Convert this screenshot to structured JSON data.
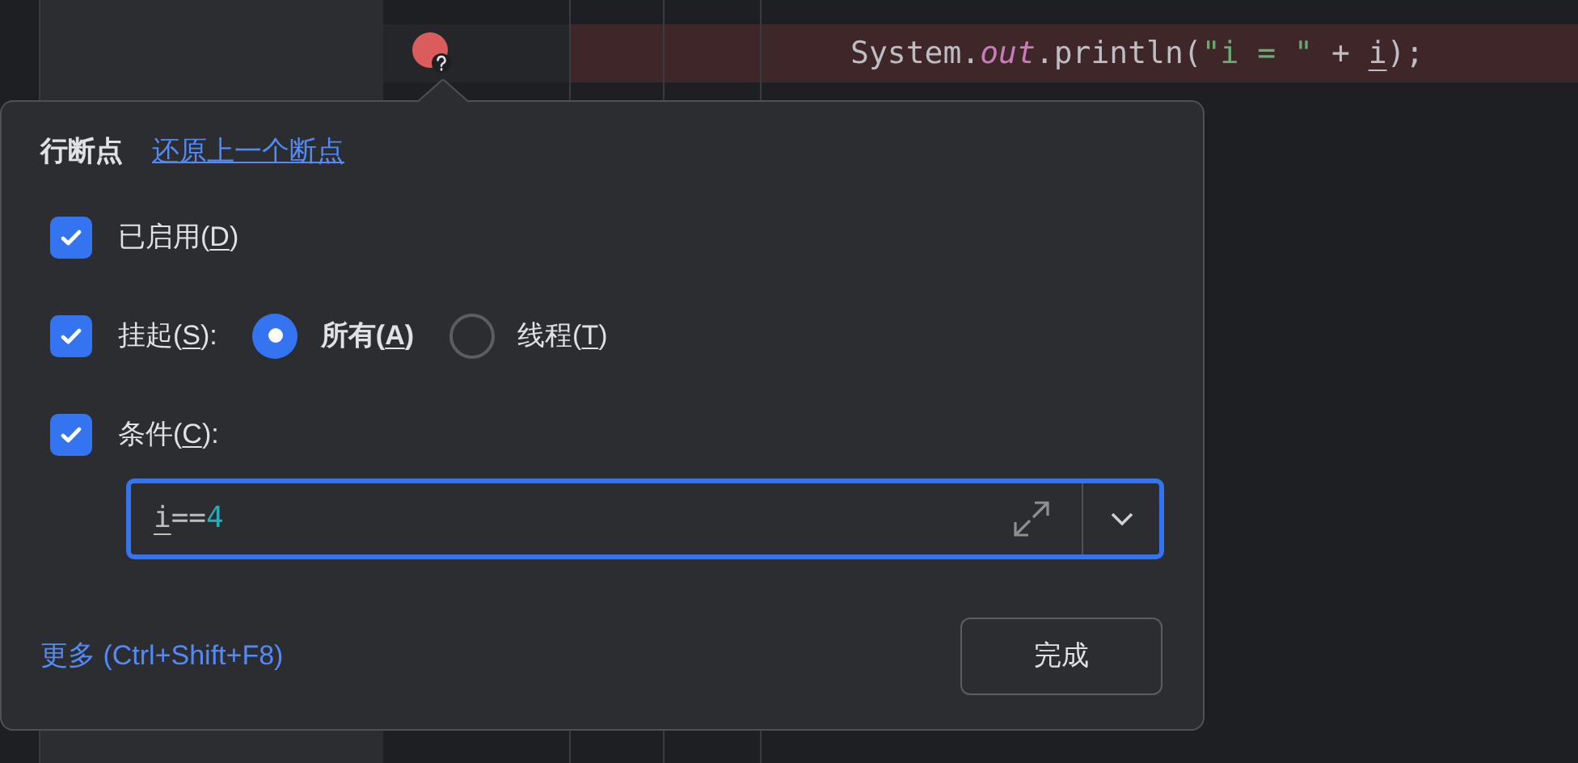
{
  "editor": {
    "code_line": [
      {
        "text": "System.",
        "kind": "plain"
      },
      {
        "text": "out",
        "kind": "field"
      },
      {
        "text": ".println(",
        "kind": "plain"
      },
      {
        "text": "\"i = \"",
        "kind": "string"
      },
      {
        "text": " + ",
        "kind": "plain"
      },
      {
        "text": "i",
        "kind": "variable"
      },
      {
        "text": ");",
        "kind": "plain"
      }
    ]
  },
  "popup": {
    "title": "行断点",
    "link": "还原上一个断点",
    "enabled": {
      "prefix": "已启用(",
      "mnemonic": "D",
      "suffix": ")",
      "checked": true
    },
    "suspend": {
      "prefix": "挂起(",
      "mnemonic": "S",
      "suffix": "):",
      "checked": true,
      "options": [
        {
          "prefix": "所有(",
          "mnemonic": "A",
          "suffix": ")",
          "selected": true
        },
        {
          "prefix": "线程(",
          "mnemonic": "T",
          "suffix": ")",
          "selected": false
        }
      ]
    },
    "condition": {
      "prefix": "条件(",
      "mnemonic": "C",
      "suffix": "):",
      "checked": true,
      "value": [
        {
          "text": "i",
          "kind": "variable"
        },
        {
          "text": "==",
          "kind": "plain"
        },
        {
          "text": "4",
          "kind": "number"
        }
      ]
    },
    "more_link": "更多 (Ctrl+Shift+F8)",
    "done_button": "完成"
  }
}
